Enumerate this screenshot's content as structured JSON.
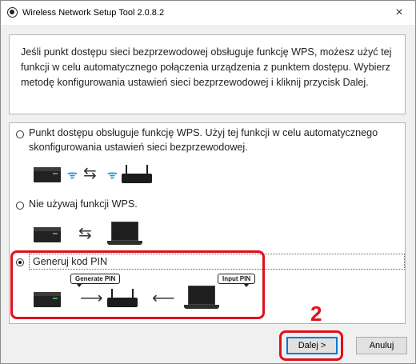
{
  "window": {
    "title": "Wireless Network Setup Tool 2.0.8.2",
    "close_glyph": "×"
  },
  "intro_text": "Jeśli punkt dostępu sieci bezprzewodowej obsługuje funkcję WPS, możesz użyć tej funkcji w celu automatycznego połączenia urządzenia z punktem dostępu. Wybierz metodę konfigurowania ustawień sieci bezprzewodowej i kliknij przycisk Dalej.",
  "options": [
    {
      "label": "Punkt dostępu obsługuje funkcję WPS. Użyj tej funkcji w celu automatycznego skonfigurowania ustawień sieci bezprzewodowej.",
      "checked": false,
      "icons": [
        "printer-icon",
        "wifi-icon",
        "swap-arrows-icon",
        "wifi-icon",
        "router-icon"
      ]
    },
    {
      "label": "Nie używaj funkcji WPS.",
      "checked": false,
      "icons": [
        "printer-icon",
        "swap-arrows-icon",
        "laptop-icon"
      ]
    },
    {
      "label": "Generuj kod PIN",
      "checked": true,
      "icons": [
        "printer-icon",
        "arrow-right-icon",
        "router-icon",
        "arrow-left-icon",
        "laptop-icon"
      ],
      "callouts": [
        "Generate PIN",
        "Input PIN"
      ]
    }
  ],
  "glyphs": {
    "wifi": "ᯤ",
    "swap": "⇆",
    "arrow_right": "⟶",
    "arrow_left": "⟵"
  },
  "annotation": {
    "step_number": "2",
    "highlight_color": "#e0101c"
  },
  "buttons": {
    "next": "Dalej >",
    "cancel": "Anuluj"
  }
}
